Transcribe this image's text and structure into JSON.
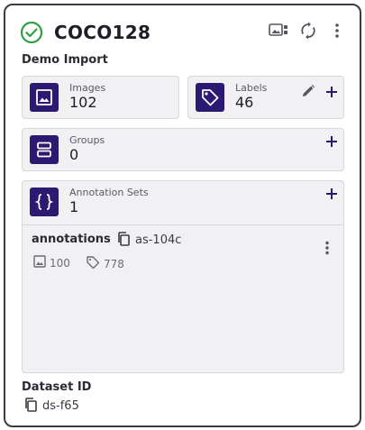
{
  "header": {
    "title": "COCO128",
    "status_icon": "check-circle-icon",
    "status_color": "#2ea043",
    "actions": [
      "view-icon",
      "sync-icon",
      "more-vert-icon"
    ]
  },
  "subtitle": "Demo Import",
  "stats": {
    "images": {
      "label": "Images",
      "value": "102",
      "icon": "image-icon"
    },
    "labels": {
      "label": "Labels",
      "value": "46",
      "icon": "tag-icon"
    },
    "groups": {
      "label": "Groups",
      "value": "0",
      "icon": "groups-icon"
    },
    "annotation_sets": {
      "label": "Annotation Sets",
      "value": "1",
      "icon": "braces-icon"
    }
  },
  "annotation_set": {
    "name": "annotations",
    "id": "as-104c",
    "images": "100",
    "labels": "778"
  },
  "dataset": {
    "label": "Dataset ID",
    "id": "ds-f65"
  },
  "colors": {
    "accent": "#2c1a72",
    "panel_bg": "#f1f1f3",
    "border": "#3c3c46"
  }
}
